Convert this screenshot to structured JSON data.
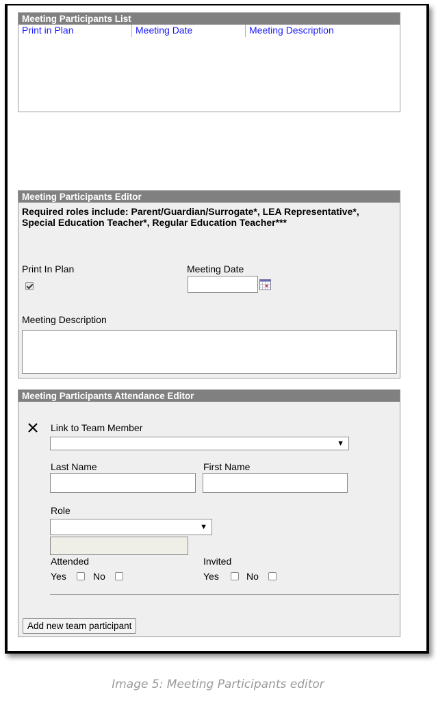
{
  "list_panel": {
    "title": "Meeting Participants List",
    "columns": [
      "Print in Plan",
      "Meeting Date",
      "Meeting Description"
    ]
  },
  "editor_panel": {
    "title": "Meeting Participants Editor",
    "required_roles_text": "Required roles include: Parent/Guardian/Surrogate*, LEA Representative*, Special Education Teacher*, Regular Education Teacher***",
    "print_in_plan_label": "Print In Plan",
    "print_in_plan_checked": true,
    "meeting_date_label": "Meeting Date",
    "meeting_date_value": "",
    "meeting_description_label": "Meeting Description",
    "meeting_description_value": ""
  },
  "attendance_panel": {
    "title": "Meeting Participants Attendance Editor",
    "link_label": "Link to Team Member",
    "link_value": "",
    "last_name_label": "Last Name",
    "first_name_label": "First Name",
    "role_label": "Role",
    "role_value": "",
    "attended_label": "Attended",
    "invited_label": "Invited",
    "yes_label": "Yes",
    "no_label": "No",
    "add_button_label": "Add new team participant"
  },
  "caption": "Image 5: Meeting Participants editor"
}
